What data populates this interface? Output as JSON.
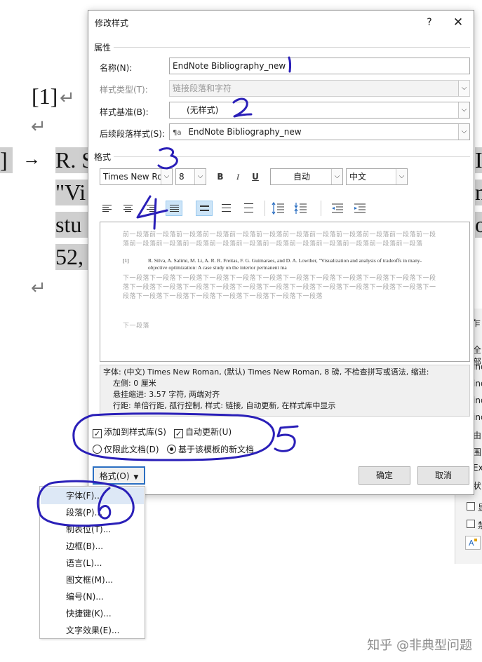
{
  "background_doc": {
    "ref_number": "[1]",
    "line_prefix": "]",
    "tab_arrow": "→",
    "line1": "R. S",
    "line2": "\"Vi",
    "line3": "stu",
    "line4": "52,",
    "right_clip1": "I",
    "right_clip2": "n",
    "right_clip3": "ot",
    "pilcrow": "↵"
  },
  "right_pane": {
    "t1": "乍",
    "t2": "全部",
    "t3": "ind",
    "t4": "ind",
    "t5": "ind",
    "t6": "ind",
    "t7": "由",
    "t8": "围",
    "t9": "Ex",
    "t10": "状",
    "t11": "显",
    "t12": "禁"
  },
  "dialog": {
    "title": "修改样式",
    "help": "?",
    "close": "✕",
    "props_section": "属性",
    "name_label": "名称(N):",
    "name_value": "EndNote Bibliography_new",
    "type_label": "样式类型(T):",
    "type_value": "链接段落和字符",
    "base_label": "样式基准(B):",
    "base_value": "(无样式)",
    "next_label": "后续段落样式(S):",
    "next_icon": "¶a",
    "next_value": "EndNote Bibliography_new",
    "format_section": "格式",
    "font_name": "Times New Roman",
    "font_size": "8",
    "bold": "B",
    "italic": "I",
    "underline": "U",
    "color": "自动",
    "lang": "中文",
    "preview_prev": "前一段落前一段落前一段落前一段落前一段落前一段落前一段落前一段落前一段落前一段落前一段落前一段落前一段落前一段落前一段落前一段落前一段落前一段落前一段落前一段落前一段落前一段落前一段落",
    "preview_ref_num": "[1]",
    "preview_ref_text": "R. Silva, A. Salimi, M. Li, A. R. R. Freitas, F. G. Guimaraes, and D. A. Lowther, \"Visualization and analysis of tradeoffs in many-objective optimization: A case study on the interior permanent ma",
    "preview_next": "下一段落下一段落下一段落下一段落下一段落下一段落下一段落下一段落下一段落下一段落下一段落下一段落下一段落下一段落下一段落下一段落下一段落下一段落下一段落下一段落下一段落下一段落下一段落下一段落下一段落下一段落下一段落下一段落下一段落下一段落下一段落",
    "preview_next2": "下一段落",
    "desc_line1": "字体: (中文) Times New Roman, (默认) Times New Roman, 8 磅, 不检查拼写或语法, 缩进:",
    "desc_line2": "左侧:  0 厘米",
    "desc_line3": "悬挂缩进: 3.57 字符, 两端对齐",
    "desc_line4": "行距: 单倍行距, 孤行控制, 样式: 链接, 自动更新, 在样式库中显示",
    "add_gallery": "添加到样式库(S)",
    "auto_update": "自动更新(U)",
    "only_doc": "仅限此文档(D)",
    "new_docs": "基于该模板的新文档",
    "format_btn": "格式(O)",
    "ok_btn": "确定",
    "cancel_btn": "取消"
  },
  "menu": {
    "items": [
      "字体(F)...",
      "段落(P)...",
      "制表位(T)...",
      "边框(B)...",
      "语言(L)...",
      "图文框(M)...",
      "编号(N)...",
      "快捷键(K)...",
      "文字效果(E)..."
    ]
  },
  "annotations": [
    "1",
    "2",
    "3",
    "4",
    "5",
    "6"
  ],
  "watermark": "知乎 @非典型问题",
  "colors": {
    "accent": "#2b6fc2",
    "annotation": "#2a1fb8",
    "highlight": "#cfcfcf"
  }
}
